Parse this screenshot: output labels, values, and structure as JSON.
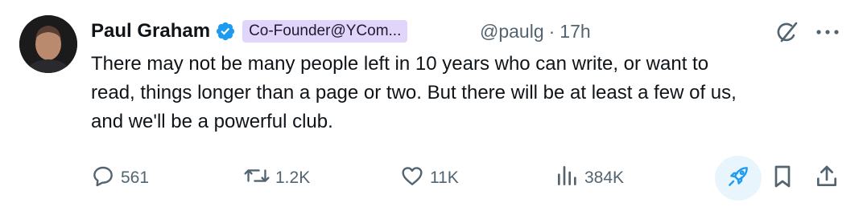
{
  "author": {
    "name": "Paul Graham",
    "affiliation": "Co-Founder@YCom...",
    "handle": "@paulg",
    "separator": "·",
    "time": "17h"
  },
  "tweet": {
    "lines": [
      "There may not be many people left in 10 years who can write, or want to",
      "read, things longer than a page or two. But there will be at least a few of us,",
      "and we'll be a powerful club."
    ]
  },
  "actions": {
    "replies": "561",
    "reposts": "1.2K",
    "likes": "11K",
    "views": "384K"
  },
  "colors": {
    "text": "#0f1419",
    "secondary": "#536471",
    "verified": "#1d9bf0",
    "affiliation_bg": "#e1d5fb",
    "boost_bg": "#e8f5fd",
    "boost_icon": "#1d9bf0"
  },
  "icons": [
    "verified-badge-icon",
    "grok-icon",
    "more-icon",
    "reply-icon",
    "repost-icon",
    "like-icon",
    "views-icon",
    "boost-icon",
    "bookmark-icon",
    "share-icon"
  ]
}
